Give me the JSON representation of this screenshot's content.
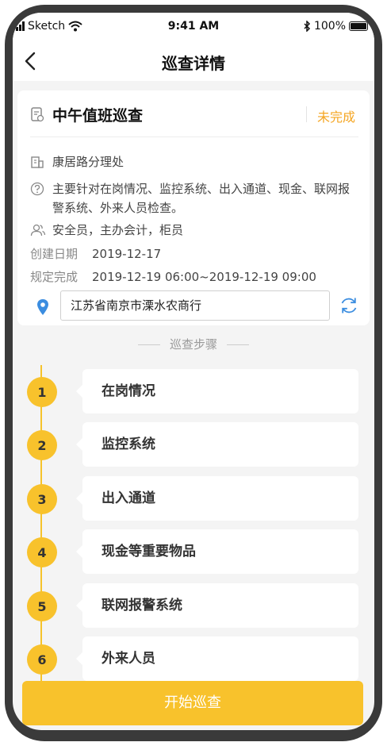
{
  "status_bar": {
    "carrier": "Sketch",
    "time": "9:41 AM",
    "battery": "100%"
  },
  "nav": {
    "title": "巡查详情",
    "back_icon": "chevron-left-icon"
  },
  "task": {
    "title": "中午值班巡查",
    "status": "未完成",
    "office": "康居路分理处",
    "description": "主要针对在岗情况、监控系统、出入通道、现金、联网报警系统、外来人员检查。",
    "roles": "安全员，主办会计，柜员",
    "created_label": "创建日期",
    "created_value": "2019-12-17",
    "due_label": "规定完成",
    "due_value": "2019-12-19 06:00~2019-12-19 09:00",
    "location": "江苏省南京市溧水农商行"
  },
  "steps_heading": "巡查步骤",
  "steps": [
    {
      "num": "1",
      "label": "在岗情况"
    },
    {
      "num": "2",
      "label": "监控系统"
    },
    {
      "num": "3",
      "label": "出入通道"
    },
    {
      "num": "4",
      "label": "现金等重要物品"
    },
    {
      "num": "5",
      "label": "联网报警系统"
    },
    {
      "num": "6",
      "label": "外来人员"
    }
  ],
  "start_button": "开始巡查",
  "colors": {
    "accent": "#f8c22c",
    "status": "#f5a623",
    "pin": "#3b8de0"
  }
}
